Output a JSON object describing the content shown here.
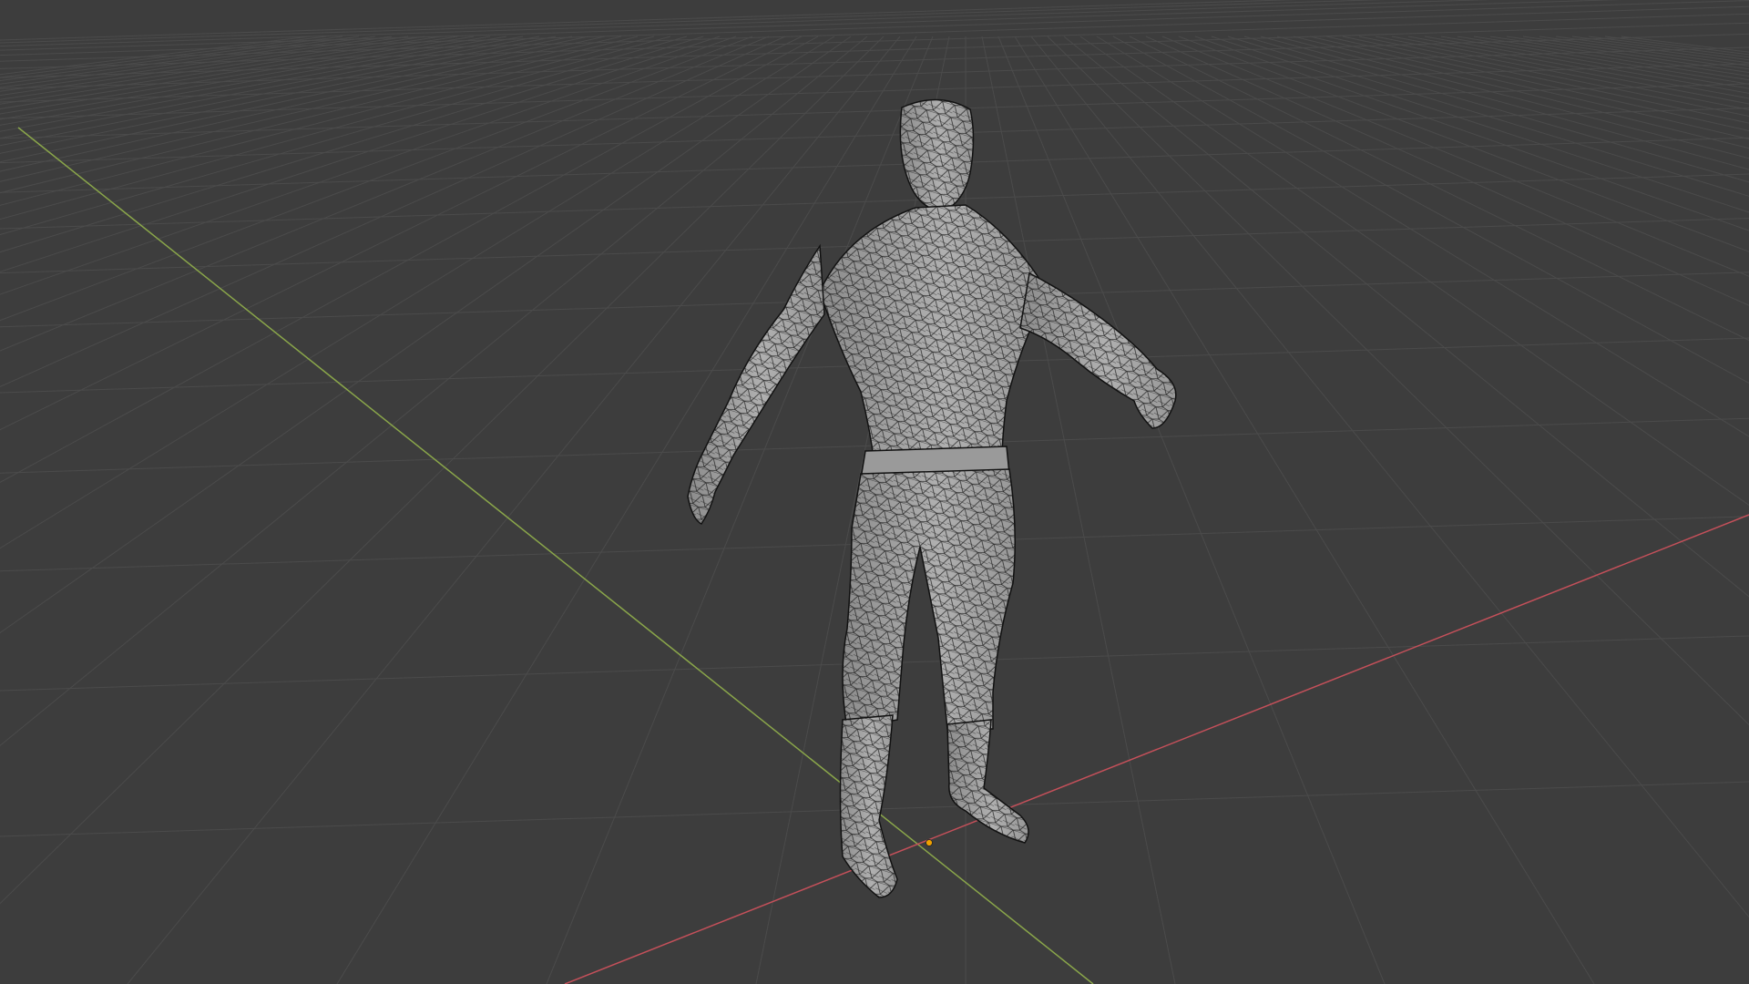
{
  "viewport": {
    "background_color": "#3d3d3d",
    "grid_color": "#4b4b4b",
    "x_axis_color": "#c4505a",
    "y_axis_color": "#8aa64a",
    "origin_marker_color": "#f0a000",
    "mesh_fill_color": "#a6a6a6",
    "mesh_shade_color": "#8e8e8e",
    "wire_color": "#1a1a1a"
  },
  "scene": {
    "object": "humanoid-character-mesh",
    "display_mode": "solid-with-wireframe",
    "icons": [
      "origin-marker-icon"
    ]
  }
}
